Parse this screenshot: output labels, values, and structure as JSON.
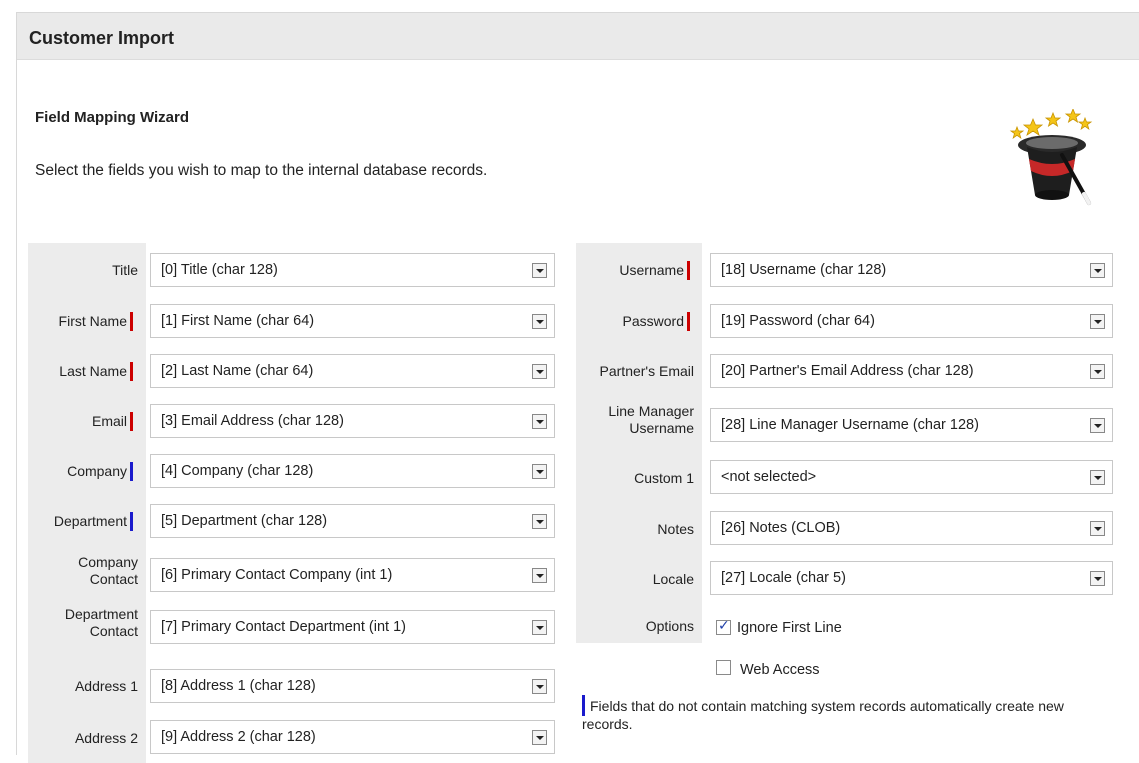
{
  "header": {
    "title": "Customer Import"
  },
  "wizard": {
    "title": "Field Mapping Wizard",
    "description": "Select the fields you wish to map to the internal database records.",
    "icon": "magic-hat-icon"
  },
  "colors": {
    "required_mark": "#cc0000",
    "create_mark": "#1a1acc"
  },
  "left_fields": [
    {
      "label": "Title",
      "value": "[0] Title (char 128)",
      "mark": "none"
    },
    {
      "label": "First Name",
      "value": "[1] First Name (char 64)",
      "mark": "red"
    },
    {
      "label": "Last Name",
      "value": "[2] Last Name (char 64)",
      "mark": "red"
    },
    {
      "label": "Email",
      "value": "[3] Email Address (char 128)",
      "mark": "red"
    },
    {
      "label": "Company",
      "value": "[4] Company (char 128)",
      "mark": "blue"
    },
    {
      "label": "Department",
      "value": "[5] Department (char 128)",
      "mark": "blue"
    },
    {
      "label_line1": "Company",
      "label_line2": "Contact",
      "value": "[6] Primary Contact Company (int 1)",
      "mark": "none"
    },
    {
      "label_line1": "Department",
      "label_line2": "Contact",
      "value": "[7] Primary Contact Department (int 1)",
      "mark": "none"
    },
    {
      "label": "Address 1",
      "value": "[8] Address 1 (char 128)",
      "mark": "none"
    },
    {
      "label": "Address 2",
      "value": "[9] Address 2 (char 128)",
      "mark": "none"
    }
  ],
  "right_fields": [
    {
      "label": "Username",
      "value": "[18] Username (char 128)",
      "mark": "red"
    },
    {
      "label": "Password",
      "value": "[19] Password (char 64)",
      "mark": "red"
    },
    {
      "label": "Partner's Email",
      "value": "[20] Partner's Email Address (char 128)",
      "mark": "none"
    },
    {
      "label_line1": "Line Manager",
      "label_line2": "Username",
      "value": "[28] Line Manager Username (char 128)",
      "mark": "none"
    },
    {
      "label": "Custom 1",
      "value": "<not selected>",
      "mark": "none"
    },
    {
      "label": "Notes",
      "value": "[26] Notes (CLOB)",
      "mark": "none"
    },
    {
      "label": "Locale",
      "value": "[27] Locale (char 5)",
      "mark": "none"
    }
  ],
  "options": {
    "label": "Options",
    "ignore_first_line": {
      "label": "Ignore First Line",
      "checked": true
    },
    "web_access": {
      "label": "Web Access",
      "checked": false
    }
  },
  "note": "Fields that do not contain matching system records automatically create new records."
}
